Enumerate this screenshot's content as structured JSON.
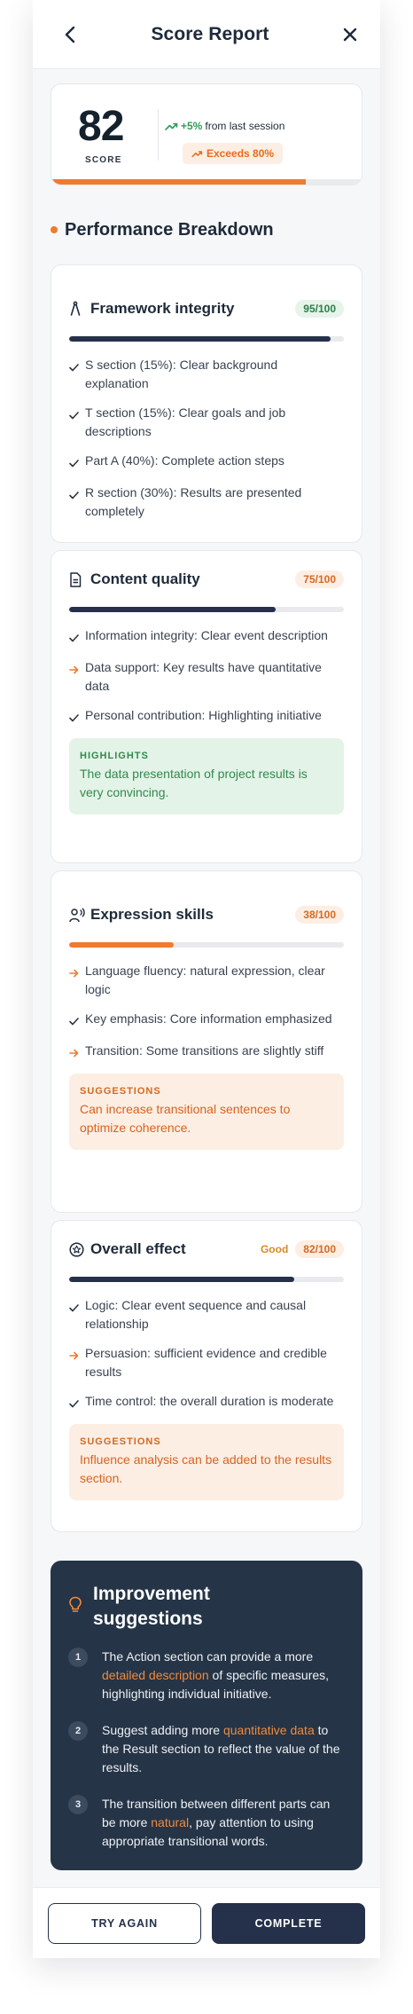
{
  "header": {
    "title": "Score Report",
    "back_icon": "chevron-left-icon",
    "close_icon": "close-icon"
  },
  "score": {
    "value": "82",
    "label": "SCORE",
    "trend_value": "+5%",
    "trend_text": "from last session",
    "exceeds": "Exceeds 80%",
    "progress_fraction": 0.82,
    "accent": "#f07a2e"
  },
  "breakdown": {
    "title": "Performance Breakdown",
    "cards": [
      {
        "title": "Framework integrity",
        "badge": "95/100",
        "progress": 0.95,
        "items": [
          {
            "status": "check",
            "text": "S section (15%): Clear background explanation"
          },
          {
            "status": "check",
            "text": "T section (15%): Clear goals and job descriptions"
          },
          {
            "status": "check",
            "text": "Part A (40%): Complete action steps"
          },
          {
            "status": "check",
            "text": "R section (30%): Results are presented completely"
          }
        ]
      },
      {
        "title": "Content quality",
        "badge": "75/100",
        "progress": 0.75,
        "items": [
          {
            "status": "check",
            "text": "Information integrity: Clear event description"
          },
          {
            "status": "arrow",
            "text": "Data support: Key results have quantitative data"
          },
          {
            "status": "check",
            "text": "Personal contribution: Highlighting initiative"
          }
        ],
        "note": {
          "label": "HIGHLIGHTS",
          "text": "The data presentation of project results is very convincing."
        }
      },
      {
        "title": "Expression skills",
        "badge": "38/100",
        "progress": 0.38,
        "items": [
          {
            "status": "arrow",
            "text": "Language fluency: natural expression, clear logic"
          },
          {
            "status": "check",
            "text": "Key emphasis: Core information emphasized"
          },
          {
            "status": "arrow",
            "text": "Transition: Some transitions are slightly stiff"
          }
        ],
        "note": {
          "label": "SUGGESTIONS",
          "text": "Can increase transitional sentences to optimize coherence."
        }
      },
      {
        "title": "Overall effect",
        "rating": "Good",
        "badge": "82/100",
        "progress": 0.82,
        "items": [
          {
            "status": "check",
            "text": "Logic: Clear event sequence and causal relationship"
          },
          {
            "status": "arrow",
            "text": "Persuasion: sufficient evidence and credible results"
          },
          {
            "status": "check",
            "text": "Time control: the overall duration is moderate"
          }
        ],
        "note": {
          "label": "SUGGESTIONS",
          "text": "Influence analysis can be added to the results section."
        }
      }
    ]
  },
  "improvement": {
    "title": "Improvement suggestions",
    "items": [
      {
        "num": "1",
        "before": "The Action section can provide a more ",
        "highlight": "detailed description",
        "after": " of specific measures, highlighting individual initiative."
      },
      {
        "num": "2",
        "before": "Suggest adding more ",
        "highlight": "quantitative data",
        "after": " to the Result section to reflect the value of the results."
      },
      {
        "num": "3",
        "before": "The transition between different parts can be more ",
        "highlight": "natural",
        "after": ", pay attention to using appropriate transitional words."
      }
    ]
  },
  "footer": {
    "try_again": "TRY AGAIN",
    "complete": "COMPLETE"
  },
  "colors": {
    "navy": "#25314a",
    "orange": "#f07a2e",
    "green": "#2e9c5b",
    "dark_panel": "#253446"
  }
}
